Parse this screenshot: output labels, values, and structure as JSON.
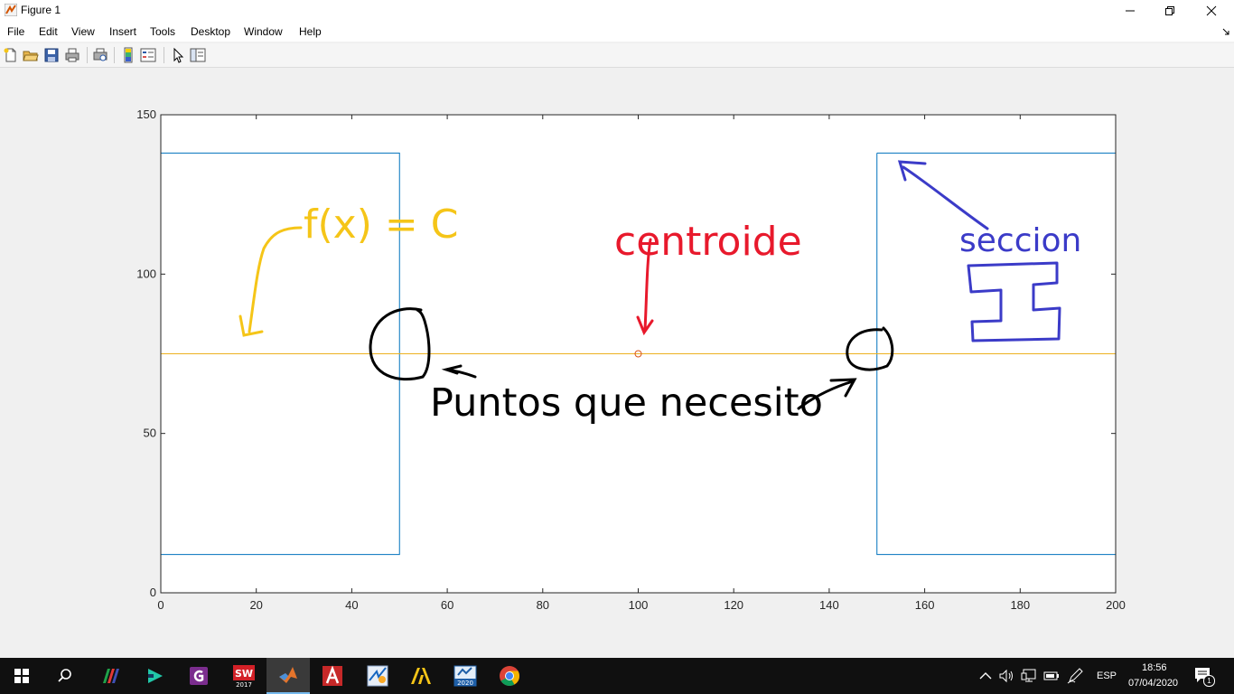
{
  "window": {
    "title": "Figure 1"
  },
  "menu": [
    "File",
    "Edit",
    "View",
    "Insert",
    "Tools",
    "Desktop",
    "Window",
    "Help"
  ],
  "toolbar_icons": [
    "new-figure-icon",
    "open-file-icon",
    "save-icon",
    "print-icon",
    "print-preview-icon",
    "colorbar-icon",
    "legend-icon",
    "pointer-icon",
    "property-editor-icon"
  ],
  "chart_data": {
    "type": "line",
    "x": {
      "lim": [
        0,
        200
      ],
      "ticks": [
        0,
        20,
        40,
        60,
        80,
        100,
        120,
        140,
        160,
        180,
        200
      ]
    },
    "y": {
      "lim": [
        0,
        150
      ],
      "ticks": [
        0,
        50,
        100,
        150
      ]
    },
    "series": [
      {
        "color": "#0072BD",
        "points": [
          [
            0,
            138
          ],
          [
            50,
            138
          ],
          [
            50,
            12
          ],
          [
            0,
            12
          ],
          [
            0,
            138
          ]
        ]
      },
      {
        "color": "#0072BD",
        "points": [
          [
            150,
            138
          ],
          [
            200,
            138
          ],
          [
            200,
            12
          ],
          [
            150,
            12
          ],
          [
            150,
            138
          ]
        ]
      },
      {
        "color": "#EDB120",
        "points": [
          [
            0,
            75
          ],
          [
            200,
            75
          ]
        ]
      }
    ],
    "markers": [
      {
        "x": 100,
        "y": 75,
        "color": "#D95319",
        "shape": "circle"
      }
    ]
  },
  "annotations": {
    "function_label": "f(x) = C",
    "centroid_label": "centroide",
    "section_label": "seccion",
    "points_label": "Puntos que necesito",
    "section_glyph": "I",
    "colors": {
      "yellow": "#F5C518",
      "red": "#E8192C",
      "blue": "#3B3BC8",
      "black": "#000000"
    }
  },
  "taskbar": {
    "apps": [
      "winrar-icon",
      "filmora-icon",
      "pdf-icon",
      "solidworks-icon",
      "matlab-icon",
      "autocad-icon",
      "mathcad-icon",
      "archicad-icon",
      "app-2020-icon",
      "chrome-icon"
    ],
    "solidworks_badge": "2017",
    "app_2020_badge": "2020",
    "language": "ESP",
    "time": "18:56",
    "date": "07/04/2020",
    "notification_count": "1"
  }
}
